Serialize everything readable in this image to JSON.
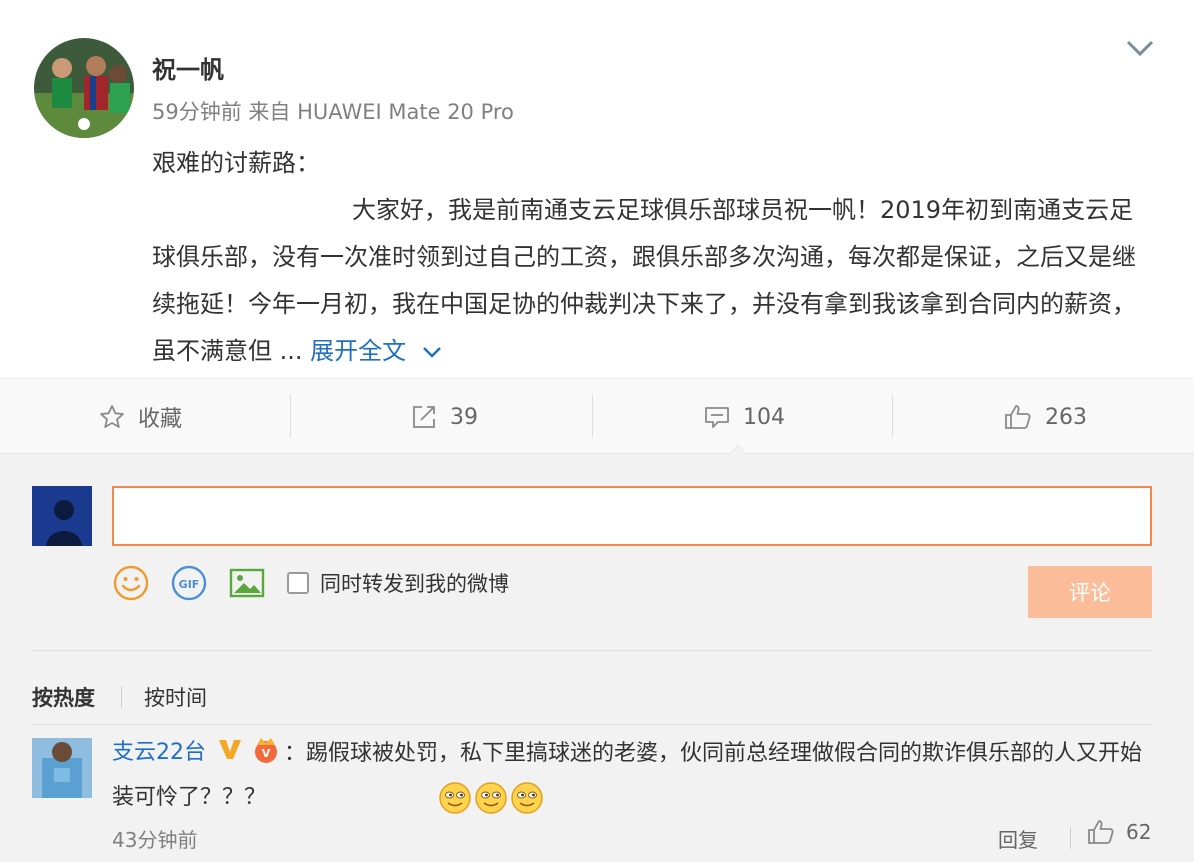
{
  "post": {
    "username": "祝一帆",
    "time": "59分钟前",
    "source": "来自 HUAWEI Mate 20 Pro",
    "title_line": "艰难的讨薪路：",
    "body": "大家好，我是前南通支云足球俱乐部球员祝一帆！2019年初到南通支云足球俱乐部，没有一次准时领到过自己的工资，跟俱乐部多次沟通，每次都是保证，之后又是继续拖延！今年一月初，我在中国足协的仲裁判决下来了，并没有拿到我该拿到合同内的薪资，虽不满意但 ...",
    "expand_label": "展开全文"
  },
  "actions": {
    "favorite_label": "收藏",
    "repost_count": "39",
    "comment_count": "104",
    "like_count": "263"
  },
  "composer": {
    "input_value": "",
    "repost_label": "同时转发到我的微博",
    "submit_label": "评论"
  },
  "sort": {
    "hot_label": "按热度",
    "time_label": "按时间"
  },
  "comment": {
    "username": "支云22台",
    "text": "：踢假球被处罚，私下里搞球迷的老婆，伙同前总经理做假合同的欺诈俱乐部的人又开始装可怜了？？？",
    "time": "43分钟前",
    "reply_label": "回复",
    "like_count": "62"
  },
  "colors": {
    "link": "#1f6fc5",
    "accent_border": "#f1884c",
    "submit_bg": "#fbbc9a"
  }
}
